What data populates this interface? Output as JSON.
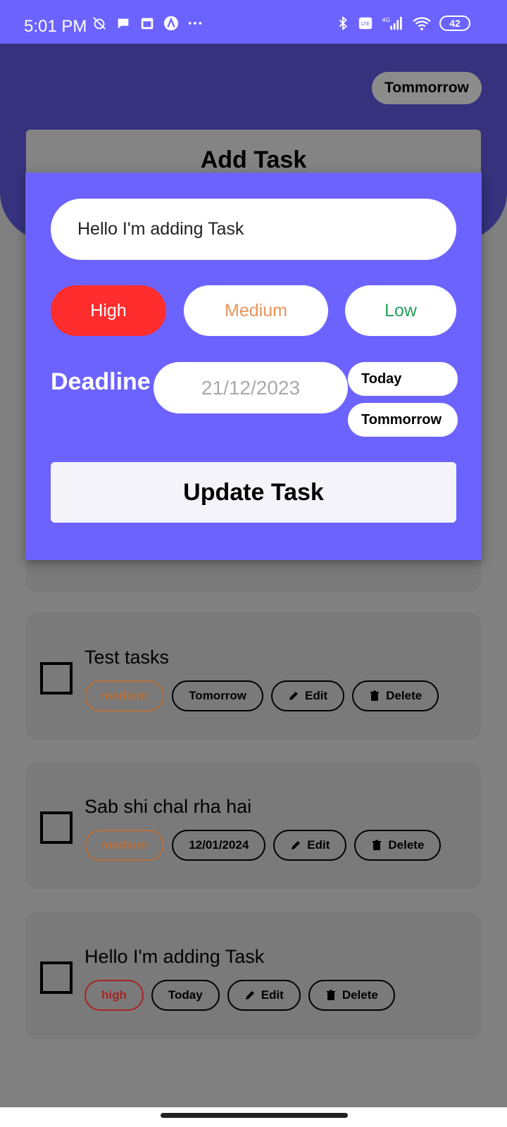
{
  "status_bar": {
    "time": "5:01 PM",
    "left_icons": [
      "muted-alarm-icon",
      "chat-bubble-icon",
      "calendar-icon",
      "app-a-icon",
      "more-dots-icon"
    ],
    "right_icons": [
      "bluetooth-icon",
      "volte-icon",
      "signal-4g-icon",
      "wifi-icon"
    ],
    "battery": "42"
  },
  "header": {
    "pill_label": "Tommorrow",
    "add_task_label": "Add Task"
  },
  "modal": {
    "task_input_value": "Hello I'm adding Task",
    "priorities": [
      {
        "label": "High",
        "selected": true,
        "color": "#ff2d2d"
      },
      {
        "label": "Medium",
        "selected": false,
        "color": "#e8955a"
      },
      {
        "label": "Low",
        "selected": false,
        "color": "#24a05a"
      }
    ],
    "deadline_label": "Deadline",
    "date_placeholder": "21/12/2023",
    "quick_dates": [
      "Today",
      "Tommorrow"
    ],
    "update_label": "Update Task",
    "background": "#6c63ff"
  },
  "tasks": [
    {
      "title": "Test tasks",
      "priority": "medium",
      "deadline": "Tomorrow",
      "edit": "Edit",
      "delete": "Delete"
    },
    {
      "title": "Sab shi chal rha hai",
      "priority": "medium",
      "deadline": "12/01/2024",
      "edit": "Edit",
      "delete": "Delete"
    },
    {
      "title": "Hello I'm adding Task",
      "priority": "high",
      "deadline": "Today",
      "edit": "Edit",
      "delete": "Delete"
    }
  ]
}
